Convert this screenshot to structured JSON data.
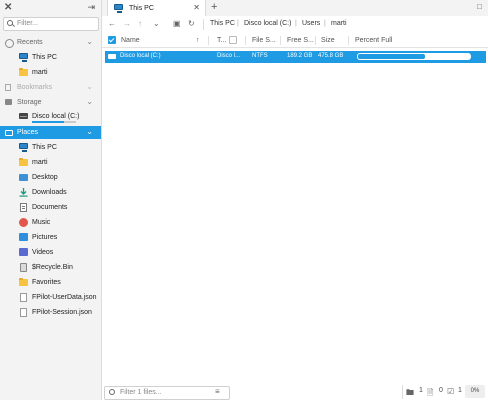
{
  "sidebar": {
    "logo": "✕",
    "collapse_icon": "sidebar-collapse-icon",
    "filter_placeholder": "Filter...",
    "sections": {
      "recents": "Recents",
      "bookmarks": "Bookmarks",
      "storage": "Storage",
      "places": "Places"
    },
    "recents": [
      {
        "label": "This PC",
        "icon": "computer-icon"
      },
      {
        "label": "marti",
        "icon": "folder-icon"
      }
    ],
    "storage": [
      {
        "label": "Disco local (C:)",
        "icon": "drive-icon",
        "used_fraction": 0.72
      }
    ],
    "places": [
      {
        "label": "This PC",
        "icon": "computer-icon"
      },
      {
        "label": "marti",
        "icon": "folder-icon"
      },
      {
        "label": "Desktop",
        "icon": "desktop-icon"
      },
      {
        "label": "Downloads",
        "icon": "download-icon"
      },
      {
        "label": "Documents",
        "icon": "document-icon"
      },
      {
        "label": "Music",
        "icon": "music-icon"
      },
      {
        "label": "Pictures",
        "icon": "pictures-icon"
      },
      {
        "label": "Videos",
        "icon": "videos-icon"
      },
      {
        "label": "$Recycle.Bin",
        "icon": "recycle-bin-icon"
      },
      {
        "label": "Favorites",
        "icon": "folder-icon"
      },
      {
        "label": "FPilot-UserData.json",
        "icon": "file-icon"
      },
      {
        "label": "FPilot-Session.json",
        "icon": "file-icon"
      }
    ]
  },
  "tabs": [
    {
      "label": "This PC",
      "icon": "computer-icon"
    }
  ],
  "breadcrumb": [
    "This PC",
    "Disco local (C:)",
    "Users",
    "marti"
  ],
  "columns": {
    "name": "Name",
    "type": "T...",
    "filesystem": "File S...",
    "free": "Free S...",
    "size": "Size",
    "percent": "Percent Full"
  },
  "rows": [
    {
      "name": "Disco local (C:)",
      "type": "Disco l...",
      "filesystem": "NTFS",
      "free": "189.2 GB",
      "size": "475.8 GB",
      "percent_full": 0.6
    }
  ],
  "bottom": {
    "filter_placeholder": "Filter 1 files...",
    "folders_count": "1",
    "files_count": "0",
    "selected_count": "1",
    "zoom": "0%"
  },
  "colors": {
    "accent": "#1e9be2",
    "sidebar_bg": "#f3f3f3"
  }
}
